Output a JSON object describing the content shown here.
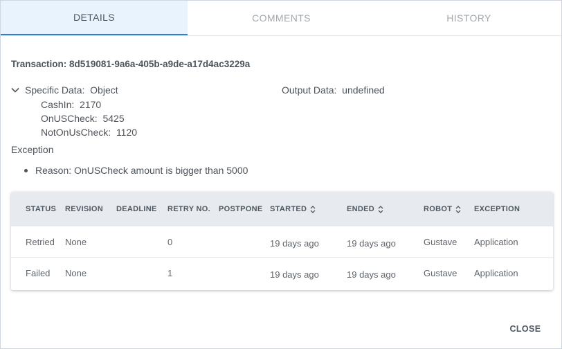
{
  "tabs": [
    {
      "label": "DETAILS",
      "active": true
    },
    {
      "label": "COMMENTS",
      "active": false
    },
    {
      "label": "HISTORY",
      "active": false
    }
  ],
  "transaction": {
    "label": "Transaction:",
    "id": "8d519081-9a6a-405b-a9de-a17d4ac3229a"
  },
  "specific_data": {
    "label": "Specific Data:",
    "value": "Object",
    "expanded": true,
    "children": [
      {
        "key": "CashIn:",
        "value": "2170"
      },
      {
        "key": "OnUSCheck:",
        "value": "5425"
      },
      {
        "key": "NotOnUsCheck:",
        "value": "1120"
      }
    ]
  },
  "output_data": {
    "label": "Output Data:",
    "value": "undefined"
  },
  "exception": {
    "title": "Exception",
    "items": [
      {
        "label": "Reason:",
        "value": "OnUSCheck amount is bigger than 5000"
      }
    ]
  },
  "table": {
    "columns": [
      {
        "label": "STATUS",
        "sortable": false
      },
      {
        "label": "REVISION",
        "sortable": false
      },
      {
        "label": "DEADLINE",
        "sortable": false
      },
      {
        "label": "RETRY NO.",
        "sortable": false
      },
      {
        "label": "POSTPONE",
        "sortable": false
      },
      {
        "label": "STARTED",
        "sortable": true
      },
      {
        "label": "ENDED",
        "sortable": true
      },
      {
        "label": "ROBOT",
        "sortable": true
      },
      {
        "label": "EXCEPTION",
        "sortable": false
      }
    ],
    "rows": [
      {
        "status": "Retried",
        "revision": "None",
        "deadline": "",
        "retry_no": "0",
        "postpone": "",
        "started": "19 days ago",
        "ended": "19 days ago",
        "robot": "Gustave",
        "exception": "Application"
      },
      {
        "status": "Failed",
        "revision": "None",
        "deadline": "",
        "retry_no": "1",
        "postpone": "",
        "started": "19 days ago",
        "ended": "19 days ago",
        "robot": "Gustave",
        "exception": "Application"
      }
    ]
  },
  "actions": {
    "close_label": "CLOSE"
  },
  "colors": {
    "accent": "#2f7fd1",
    "active_tab_bg": "#e9f3fd",
    "table_header_bg": "#e7ebef"
  },
  "icons": {
    "expand": "chevron-down-icon",
    "sort": "sort-updown-icon"
  }
}
